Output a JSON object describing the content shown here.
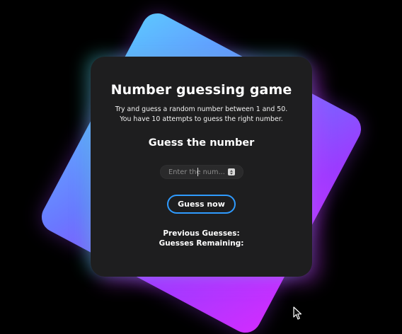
{
  "game": {
    "title": "Number guessing game",
    "description_line1": "Try and guess a random number between 1 and 50.",
    "description_line2": "You have 10 attempts to guess the right number.",
    "subtitle": "Guess the number",
    "input": {
      "placeholder": "Enter the num...",
      "value": ""
    },
    "button_label": "Guess now",
    "previous_guesses_label": "Previous Guesses:",
    "guesses_remaining_label": "Guesses Remaining:"
  },
  "theme": {
    "background": "#000000",
    "card": "#1e1e1f",
    "button_border": "#2f9bff",
    "gradient_start": "#5cc6ff",
    "gradient_end": "#d12cff"
  },
  "icons": {
    "stepper": "number-stepper-icon",
    "pointer": "mouse-pointer-icon"
  }
}
